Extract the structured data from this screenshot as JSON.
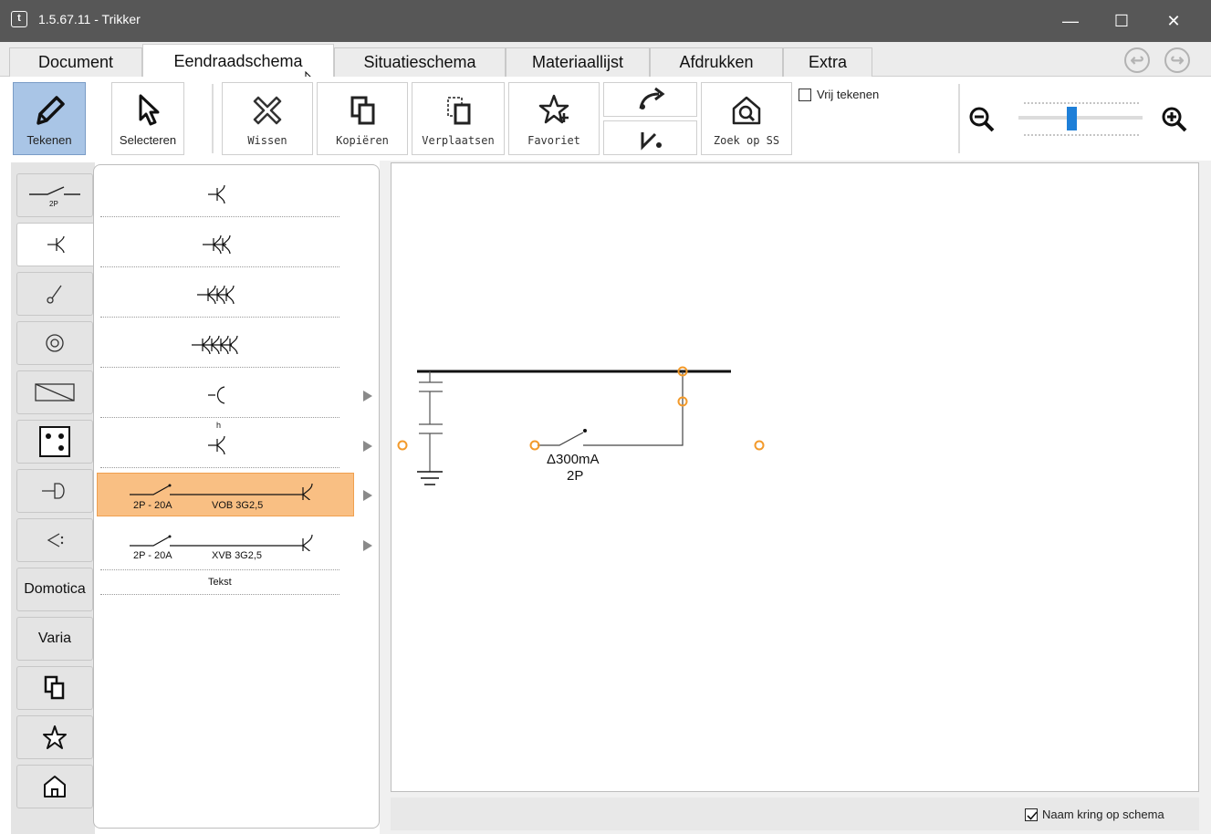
{
  "window": {
    "title": "1.5.67.11 - Trikker",
    "icon_letter": "t",
    "controls": {
      "minimize": "—",
      "maximize": "☐",
      "close": "✕"
    }
  },
  "tabs": [
    {
      "label": "Document",
      "active": false
    },
    {
      "label": "Eendraadschema",
      "active": true
    },
    {
      "label": "Situatieschema",
      "active": false
    },
    {
      "label": "Materiaallijst",
      "active": false
    },
    {
      "label": "Afdrukken",
      "active": false
    },
    {
      "label": "Extra",
      "active": false
    }
  ],
  "toolbar": {
    "draw_label": "Tekenen",
    "select_label": "Selecteren",
    "erase_label": "Wissen",
    "copy_label": "Kopiëren",
    "move_label": "Verplaatsen",
    "favorite_label": "Favoriet",
    "find_label": "Zoek op SS",
    "free_draw_label": "Vrij tekenen"
  },
  "zoom": {
    "level": 0.42
  },
  "rail": {
    "domotica_label": "Domotica",
    "varia_label": "Varia",
    "switch_badge": "2P"
  },
  "palette": {
    "items": [
      {
        "label1": "2P - 20A",
        "label2": "VOB 3G2,5"
      },
      {
        "label1": "2P - 20A",
        "label2": "XVB 3G2,5"
      }
    ],
    "text_item": "Tekst",
    "sub_h": "h"
  },
  "canvas": {
    "rcd_label": "Δ300mA",
    "rcd_poles": "2P"
  },
  "statusbar": {
    "name_on_schema_label": "Naam kring op schema",
    "name_on_schema_checked": true
  },
  "colors": {
    "accent_selection": "#f9bf83",
    "active_tool": "#a9c5e6",
    "connector": "#f39a2b",
    "zoom_thumb": "#1e7fd8"
  }
}
